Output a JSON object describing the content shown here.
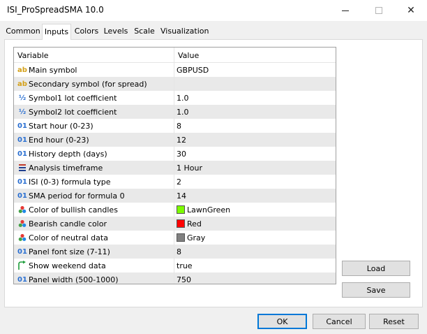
{
  "window": {
    "title": "ISI_ProSpreadSMA 10.0",
    "close_glyph": "✕"
  },
  "tabs": [
    {
      "label": "Common"
    },
    {
      "label": "Inputs"
    },
    {
      "label": "Colors"
    },
    {
      "label": "Levels"
    },
    {
      "label": "Scale"
    },
    {
      "label": "Visualization"
    }
  ],
  "active_tab": "Inputs",
  "grid": {
    "header": {
      "variable": "Variable",
      "value": "Value"
    },
    "rows": [
      {
        "icon": "ab",
        "icon_name": "string-type-icon",
        "name": "Main symbol",
        "value": "GBPUSD"
      },
      {
        "icon": "ab",
        "icon_name": "string-type-icon",
        "name": "Secondary symbol (for spread)",
        "value": ""
      },
      {
        "icon": "½",
        "icon_name": "double-type-icon",
        "name": "Symbol1 lot coefficient",
        "value": "1.0"
      },
      {
        "icon": "½",
        "icon_name": "double-type-icon",
        "name": "Symbol2 lot coefficient",
        "value": "1.0"
      },
      {
        "icon": "01",
        "icon_name": "integer-type-icon",
        "name": "Start hour (0-23)",
        "value": "8"
      },
      {
        "icon": "01",
        "icon_name": "integer-type-icon",
        "name": "End hour (0-23)",
        "value": "12"
      },
      {
        "icon": "01",
        "icon_name": "integer-type-icon",
        "name": "History depth (days)",
        "value": "30"
      },
      {
        "icon": "☰",
        "icon_name": "enum-type-icon",
        "name": "Analysis timeframe",
        "value": "1 Hour"
      },
      {
        "icon": "01",
        "icon_name": "integer-type-icon",
        "name": "ISI (0-3) formula type",
        "value": "2"
      },
      {
        "icon": "01",
        "icon_name": "integer-type-icon",
        "name": "SMA period for formula 0",
        "value": "14"
      },
      {
        "icon": "color",
        "icon_name": "color-type-icon",
        "name": "Color of bullish candles",
        "value": "LawnGreen",
        "swatch": "#7cfc00"
      },
      {
        "icon": "color",
        "icon_name": "color-type-icon",
        "name": "Bearish candle color",
        "value": "Red",
        "swatch": "#ff0000"
      },
      {
        "icon": "color",
        "icon_name": "color-type-icon",
        "name": "Color of neutral data",
        "value": "Gray",
        "swatch": "#808080"
      },
      {
        "icon": "01",
        "icon_name": "integer-type-icon",
        "name": "Panel font size (7-11)",
        "value": "8"
      },
      {
        "icon": "bool",
        "icon_name": "bool-type-icon",
        "name": "Show weekend data",
        "value": "true"
      },
      {
        "icon": "01",
        "icon_name": "integer-type-icon",
        "name": "Panel width (500-1000)",
        "value": "750"
      }
    ]
  },
  "side_buttons": {
    "load": "Load",
    "save": "Save"
  },
  "footer_buttons": {
    "ok": "OK",
    "cancel": "Cancel",
    "reset": "Reset"
  },
  "colors": {
    "accent": "#0078d7",
    "alt_row": "#e9e9e9"
  }
}
